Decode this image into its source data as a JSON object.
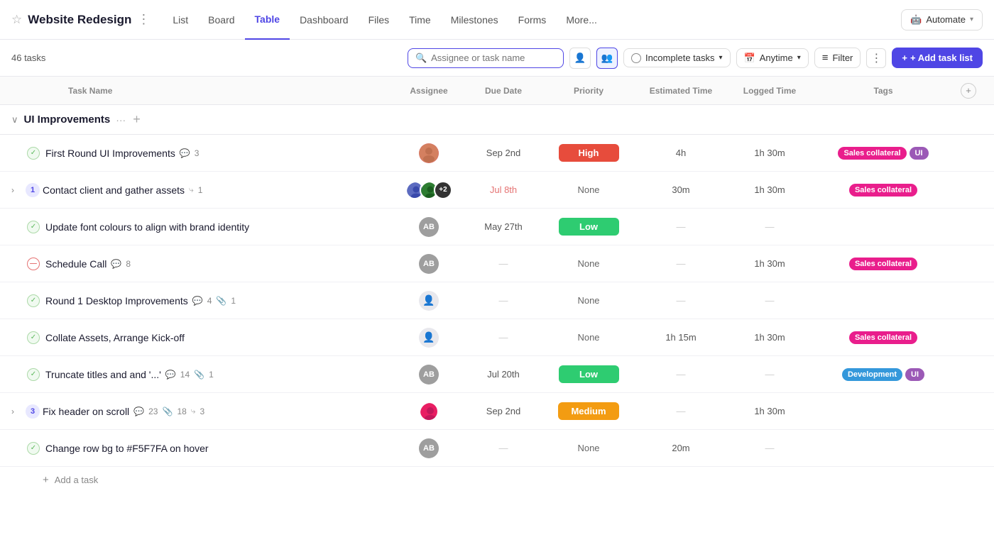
{
  "project": {
    "name": "Website Redesign",
    "task_count": "46 tasks"
  },
  "nav": {
    "tabs": [
      "List",
      "Board",
      "Table",
      "Dashboard",
      "Files",
      "Time",
      "Milestones",
      "Forms",
      "More..."
    ],
    "active_tab": "Table",
    "automate_label": "Automate"
  },
  "toolbar": {
    "search_placeholder": "Assignee or task name",
    "incomplete_tasks_label": "Incomplete tasks",
    "anytime_label": "Anytime",
    "filter_label": "Filter",
    "add_task_list_label": "+ Add task list"
  },
  "table": {
    "columns": [
      "Task Name",
      "Assignee",
      "Due Date",
      "Priority",
      "Estimated Time",
      "Logged Time",
      "Tags"
    ]
  },
  "group": {
    "name": "UI Improvements"
  },
  "tasks": [
    {
      "id": 1,
      "status": "done",
      "expand": false,
      "num": null,
      "indent": false,
      "name": "First Round UI Improvements",
      "comments": 3,
      "attachments": null,
      "subtasks": null,
      "assignee": [
        {
          "initials": "AB",
          "color": "#e91e63",
          "is_photo": true,
          "photo_color": "#c2185b"
        }
      ],
      "due_date": "Sep 2nd",
      "due_overdue": false,
      "priority": "High",
      "priority_class": "priority-high",
      "est_time": "4h",
      "logged_time": "1h 30m",
      "tags": [
        {
          "label": "Sales collateral",
          "class": "tag-sales"
        },
        {
          "label": "UI",
          "class": "tag-ui"
        }
      ]
    },
    {
      "id": 2,
      "status": "normal",
      "expand": true,
      "num": 1,
      "indent": false,
      "name": "Contact client and gather assets",
      "comments": null,
      "attachments": null,
      "subtasks": 1,
      "assignee": [
        {
          "initials": "P1",
          "color": "#1565c0",
          "is_photo": true
        },
        {
          "initials": "P2",
          "color": "#558b2f",
          "is_photo": true
        }
      ],
      "assignee_more": "+2",
      "due_date": "Jul 8th",
      "due_overdue": true,
      "priority": "None",
      "priority_class": "priority-none",
      "est_time": "30m",
      "logged_time": "1h 30m",
      "tags": [
        {
          "label": "Sales collateral",
          "class": "tag-sales"
        }
      ]
    },
    {
      "id": 3,
      "status": "done",
      "expand": false,
      "num": null,
      "indent": false,
      "name": "Update font colours to align with brand identity",
      "comments": null,
      "attachments": null,
      "subtasks": null,
      "assignee": [
        {
          "initials": "AB",
          "color": "#9e9e9e",
          "is_photo": false
        }
      ],
      "due_date": "May 27th",
      "due_overdue": false,
      "priority": "Low",
      "priority_class": "priority-low",
      "est_time": null,
      "logged_time": null,
      "tags": []
    },
    {
      "id": 4,
      "status": "blocked",
      "expand": false,
      "num": null,
      "indent": false,
      "name": "Schedule Call",
      "comments": 8,
      "attachments": null,
      "subtasks": null,
      "assignee": [
        {
          "initials": "AB",
          "color": "#9e9e9e",
          "is_photo": false
        }
      ],
      "due_date": null,
      "due_overdue": false,
      "priority": "None",
      "priority_class": "priority-none",
      "est_time": null,
      "logged_time": "1h 30m",
      "tags": [
        {
          "label": "Sales collateral",
          "class": "tag-sales"
        }
      ]
    },
    {
      "id": 5,
      "status": "done",
      "expand": false,
      "num": null,
      "indent": false,
      "name": "Round 1 Desktop Improvements",
      "comments": 4,
      "attachments": 1,
      "subtasks": null,
      "assignee": [
        {
          "initials": "?",
          "color": "#e0e0e0",
          "is_photo": false,
          "is_empty": true
        }
      ],
      "due_date": null,
      "due_overdue": false,
      "priority": "None",
      "priority_class": "priority-none",
      "est_time": null,
      "logged_time": null,
      "tags": []
    },
    {
      "id": 6,
      "status": "done",
      "expand": false,
      "num": null,
      "indent": false,
      "name": "Collate Assets, Arrange Kick-off",
      "comments": null,
      "attachments": null,
      "subtasks": null,
      "assignee": [
        {
          "initials": "?",
          "color": "#e0e0e0",
          "is_photo": false,
          "is_empty": true
        }
      ],
      "due_date": null,
      "due_overdue": false,
      "priority": "None",
      "priority_class": "priority-none",
      "est_time": "1h 15m",
      "logged_time": "1h 30m",
      "tags": [
        {
          "label": "Sales collateral",
          "class": "tag-sales"
        }
      ]
    },
    {
      "id": 7,
      "status": "done",
      "expand": false,
      "num": null,
      "indent": false,
      "name": "Truncate titles and and '...'",
      "comments": 14,
      "attachments": 1,
      "subtasks": null,
      "assignee": [
        {
          "initials": "AB",
          "color": "#9e9e9e",
          "is_photo": false
        }
      ],
      "due_date": "Jul 20th",
      "due_overdue": false,
      "priority": "Low",
      "priority_class": "priority-low",
      "est_time": null,
      "logged_time": null,
      "tags": [
        {
          "label": "Development",
          "class": "tag-dev"
        },
        {
          "label": "UI",
          "class": "tag-ui"
        }
      ]
    },
    {
      "id": 8,
      "status": "normal",
      "expand": true,
      "num": 3,
      "indent": false,
      "name": "Fix header on scroll",
      "comments": 23,
      "attachments": 18,
      "subtasks": 3,
      "assignee": [
        {
          "initials": "P3",
          "color": "#e91e63",
          "is_photo": true,
          "photo_color": "#e91e63"
        }
      ],
      "due_date": "Sep 2nd",
      "due_overdue": false,
      "priority": "Medium",
      "priority_class": "priority-medium",
      "est_time": null,
      "logged_time": "1h 30m",
      "tags": []
    },
    {
      "id": 9,
      "status": "done",
      "expand": false,
      "num": null,
      "indent": false,
      "name": "Change row bg to #F5F7FA on hover",
      "comments": null,
      "attachments": null,
      "subtasks": null,
      "assignee": [
        {
          "initials": "AB",
          "color": "#9e9e9e",
          "is_photo": false
        }
      ],
      "due_date": null,
      "due_overdue": false,
      "priority": "None",
      "priority_class": "priority-none",
      "est_time": "20m",
      "logged_time": null,
      "tags": []
    }
  ],
  "add_task": {
    "label": "Add a task"
  },
  "icons": {
    "star": "☆",
    "more_vert": "⋮",
    "chevron_down": "▾",
    "chevron_right": "›",
    "search": "🔍",
    "person": "👤",
    "group": "👥",
    "calendar": "📅",
    "filter": "≡",
    "add": "+",
    "collapse": "∨",
    "expand_row": "›",
    "comment": "💬",
    "attachment": "📎",
    "subtask": "⤷",
    "plus": "+"
  }
}
